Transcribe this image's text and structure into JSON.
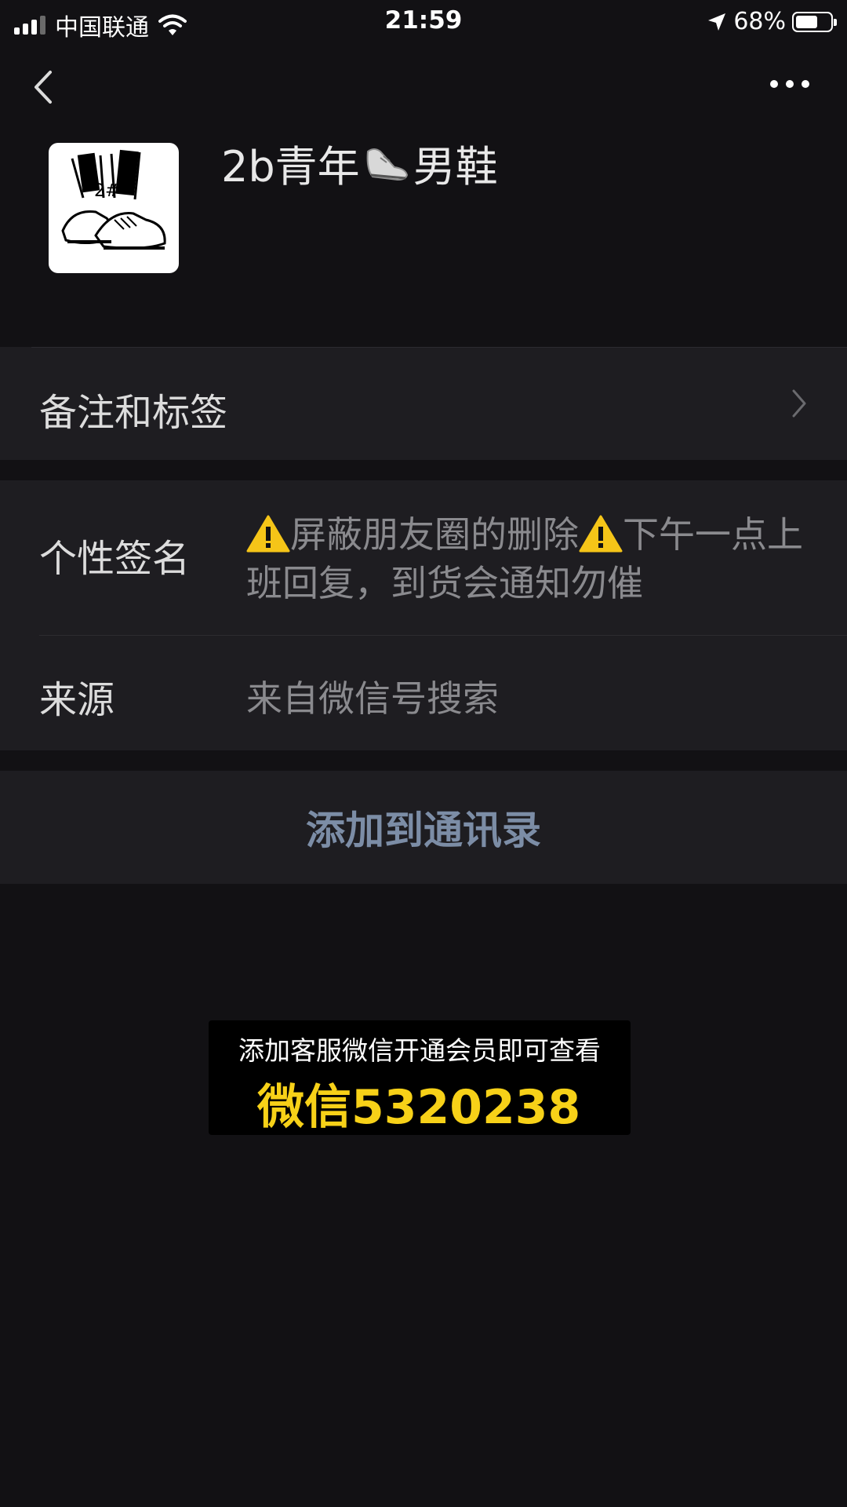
{
  "status_bar": {
    "carrier": "中国联通",
    "time": "21:59",
    "battery": "68%",
    "battery_level": 0.68
  },
  "nav": {
    "back_icon": "chevron-left-icon",
    "more_icon": "more-dots-icon"
  },
  "profile": {
    "name_prefix": "2b青年",
    "name_suffix": "男鞋",
    "name_emoji_icon": "sneaker-icon",
    "avatar_text": "2#"
  },
  "remark_row": {
    "label": "备注和标签"
  },
  "signature": {
    "label": "个性签名",
    "part1": "屏蔽朋友圈的删除",
    "part2": "下午一点上班回复，到货会通知勿催"
  },
  "source": {
    "label": "来源",
    "value": "来自微信号搜索"
  },
  "add_button": {
    "label": "添加到通讯录"
  },
  "promo": {
    "line1": "添加客服微信开通会员即可查看",
    "line2": "微信5320238"
  },
  "colors": {
    "background": "#121114",
    "row_background": "#1e1d21",
    "link_blue": "#7c8da6",
    "promo_yellow": "#f7d118"
  }
}
